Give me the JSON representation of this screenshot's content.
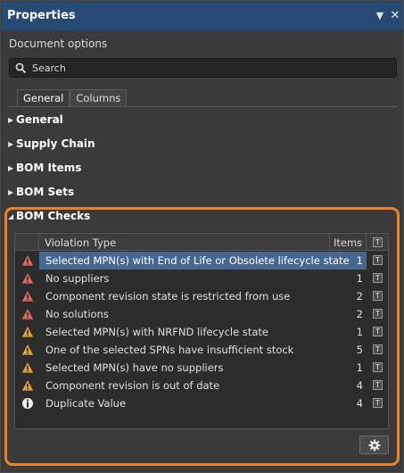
{
  "panel": {
    "title": "Properties",
    "subtitle": "Document options"
  },
  "search": {
    "placeholder": "Search"
  },
  "tabs": [
    {
      "label": "General",
      "active": true
    },
    {
      "label": "Columns",
      "active": false
    }
  ],
  "sections": [
    {
      "label": "General",
      "expanded": false
    },
    {
      "label": "Supply Chain",
      "expanded": false
    },
    {
      "label": "BOM Items",
      "expanded": false
    },
    {
      "label": "BOM Sets",
      "expanded": false
    },
    {
      "label": "BOM Checks",
      "expanded": true
    }
  ],
  "bom_checks": {
    "columns": {
      "violation_type": "Violation Type",
      "items": "Items",
      "filter_glyph": "T"
    },
    "rows": [
      {
        "severity": "error",
        "icon": "error-triangle-icon",
        "violation": "Selected MPN(s) with End of Life or Obsolete lifecycle state",
        "items": "1",
        "selected": true
      },
      {
        "severity": "error",
        "icon": "error-triangle-icon",
        "violation": "No suppliers",
        "items": "1"
      },
      {
        "severity": "error",
        "icon": "error-triangle-icon",
        "violation": "Component revision state is restricted from use",
        "items": "2"
      },
      {
        "severity": "error",
        "icon": "error-triangle-icon",
        "violation": "No solutions",
        "items": "2"
      },
      {
        "severity": "warning",
        "icon": "warning-triangle-icon",
        "violation": "Selected MPN(s) with NRFND lifecycle state",
        "items": "1"
      },
      {
        "severity": "warning",
        "icon": "warning-triangle-icon",
        "violation": "One of the selected SPNs have insufficient stock",
        "items": "5"
      },
      {
        "severity": "warning",
        "icon": "warning-triangle-icon",
        "violation": "Selected MPN(s) have no suppliers",
        "items": "1"
      },
      {
        "severity": "warning",
        "icon": "warning-triangle-icon",
        "violation": "Component revision is out of date",
        "items": "4"
      },
      {
        "severity": "info",
        "icon": "info-circle-icon",
        "violation": "Duplicate Value",
        "items": "4"
      }
    ]
  },
  "colors": {
    "titlebar": "#264a73",
    "highlight": "#e8832c",
    "error": "#e06666",
    "warning": "#e0a040",
    "selection": "#47678e"
  }
}
